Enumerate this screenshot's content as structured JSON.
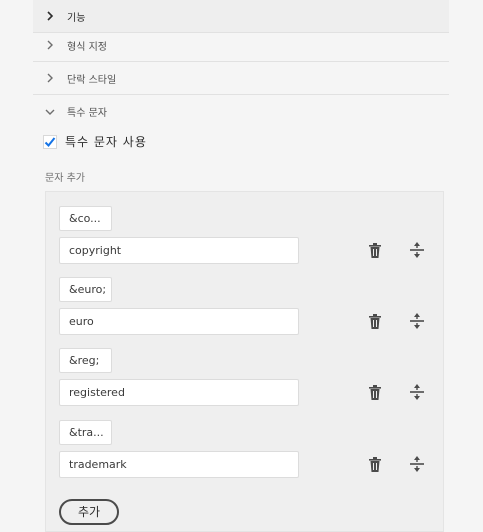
{
  "accordion": [
    {
      "label": "기능",
      "expanded": false
    },
    {
      "label": "형식 지정",
      "expanded": false
    },
    {
      "label": "단락 스타일",
      "expanded": false
    },
    {
      "label": "특수 문자",
      "expanded": true
    }
  ],
  "special_chars": {
    "checkbox_label": "특수 문자 사용",
    "checked": true,
    "section_label": "문자 추가",
    "items": [
      {
        "entity": "&co...",
        "name": "copyright"
      },
      {
        "entity": "&euro;",
        "name": "euro"
      },
      {
        "entity": "&reg;",
        "name": "registered"
      },
      {
        "entity": "&tra...",
        "name": "trademark"
      }
    ],
    "add_label": "추가"
  },
  "icons": {
    "delete": "trash-icon",
    "reorder": "move-handle-icon",
    "chevron_collapsed": "chevron-right-icon",
    "chevron_expanded": "chevron-down-icon"
  },
  "colors": {
    "checkbox_check": "#1473e6",
    "panel_bg": "#f5f5f5",
    "box_bg": "#efefef"
  }
}
